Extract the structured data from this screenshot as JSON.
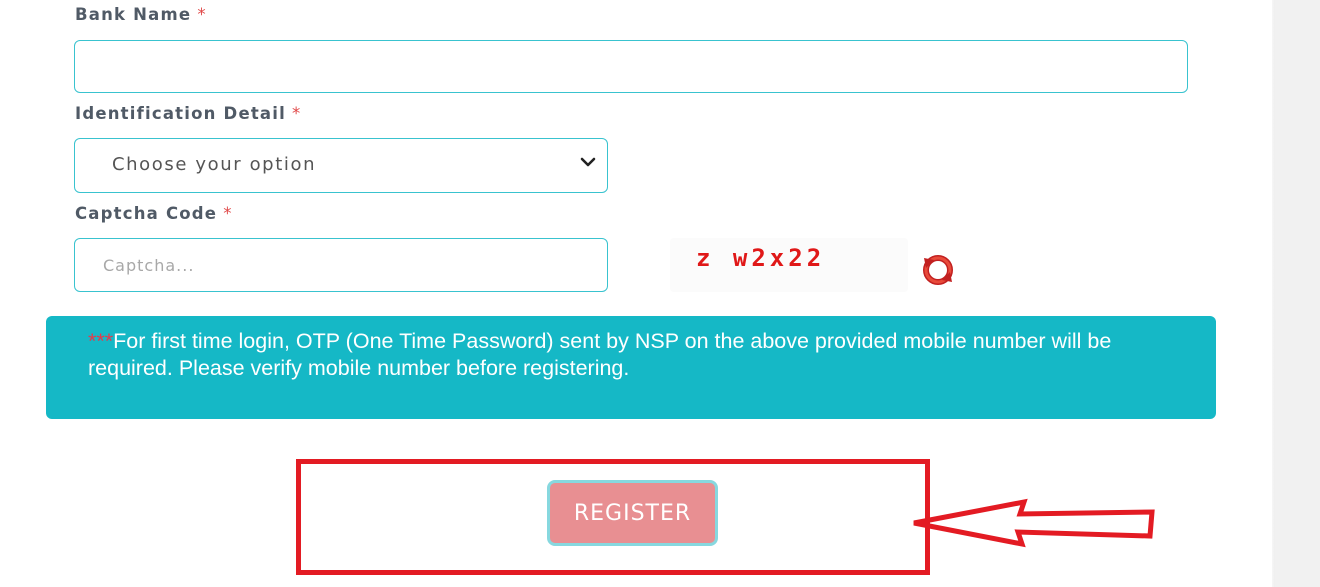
{
  "form": {
    "bank_name": {
      "label": "Bank Name",
      "required_mark": "*",
      "value": ""
    },
    "identification_detail": {
      "label": "Identification Detail",
      "required_mark": "*",
      "selected": "Choose your option"
    },
    "captcha": {
      "label": "Captcha Code",
      "required_mark": "*",
      "placeholder": "Captcha...",
      "image_text": "z w2x22"
    }
  },
  "notice": {
    "stars": "***",
    "text": "For first time login, OTP (One Time Password) sent by NSP on the above provided mobile number will be required. Please verify mobile number before registering."
  },
  "register_label": "REGISTER",
  "icons": {
    "refresh": "refresh-icon",
    "dropdown": "chevron-down-icon",
    "annotation": "arrow-left-icon"
  },
  "colors": {
    "accent_border": "#39c3cf",
    "notice_bg": "#15b8c6",
    "register_bg": "#e88f92",
    "annotation_red": "#e31b23",
    "required_red": "#e04848"
  }
}
